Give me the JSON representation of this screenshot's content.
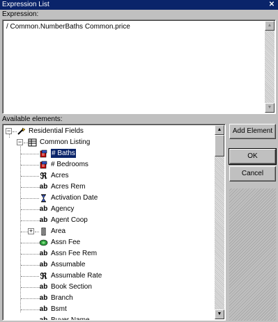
{
  "window": {
    "title": "Expression List",
    "close_glyph": "✕"
  },
  "expression": {
    "label": "Expression:",
    "value": "/ Common.NumberBaths Common.price"
  },
  "available": {
    "label": "Available elements:",
    "root": {
      "label": "Residential Fields",
      "icon": "wand-icon"
    },
    "group": {
      "label": "Common Listing",
      "icon": "table-icon"
    },
    "items": [
      {
        "label": "# Baths",
        "icon": "cube-icon",
        "selected": true
      },
      {
        "label": "# Bedrooms",
        "icon": "cube-icon"
      },
      {
        "label": "Acres",
        "icon": "real-icon"
      },
      {
        "label": "Acres Rem",
        "icon": "ab-icon"
      },
      {
        "label": "Activation Date",
        "icon": "hourglass-icon"
      },
      {
        "label": "Agency",
        "icon": "ab-icon"
      },
      {
        "label": "Agent Coop",
        "icon": "ab-icon"
      },
      {
        "label": "Area",
        "icon": "list-icon",
        "expandable": true
      },
      {
        "label": "Assn Fee",
        "icon": "money-icon"
      },
      {
        "label": "Assn Fee Rem",
        "icon": "ab-icon"
      },
      {
        "label": "Assumable",
        "icon": "ab-icon"
      },
      {
        "label": "Assumable Rate",
        "icon": "real-icon"
      },
      {
        "label": "Book Section",
        "icon": "ab-icon"
      },
      {
        "label": "Branch",
        "icon": "ab-icon"
      },
      {
        "label": "Bsmt",
        "icon": "ab-icon"
      },
      {
        "label": "Buyer Name",
        "icon": "ab-icon"
      }
    ]
  },
  "buttons": {
    "add_element": "Add Element",
    "ok": "OK",
    "cancel": "Cancel"
  },
  "glyphs": {
    "ab": "ab",
    "real": "ℜ",
    "up": "▲",
    "down": "▼",
    "expand": "+",
    "collapse": "−"
  }
}
